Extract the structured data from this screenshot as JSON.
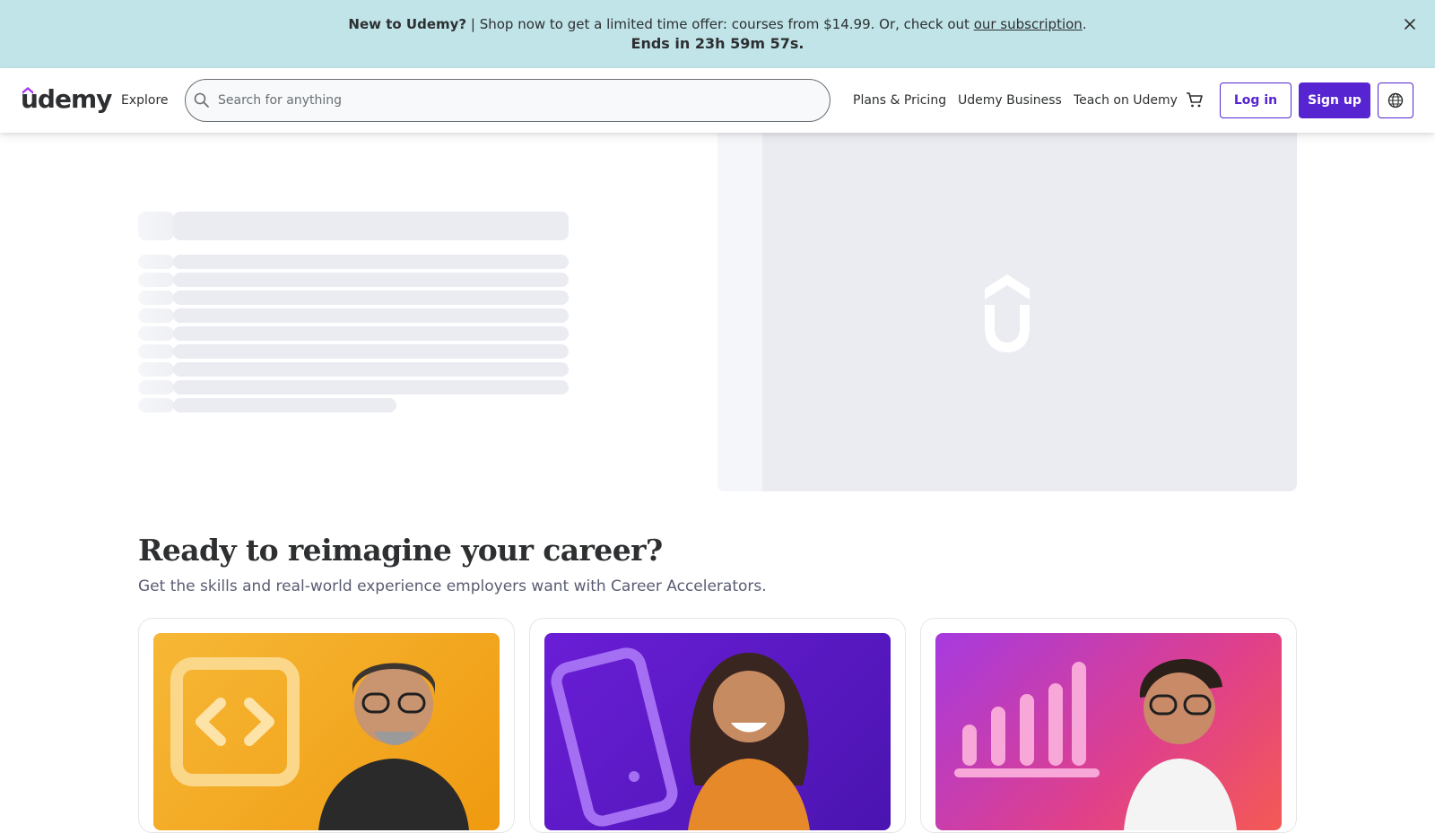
{
  "promo": {
    "bold": "New to Udemy?",
    "text": " | Shop now to get a limited time offer: courses from $14.99. Or, check out ",
    "link": "our subscription",
    "suffix": ".",
    "countdown": "Ends in 23h 59m 57s."
  },
  "header": {
    "logo": "udemy",
    "explore": "Explore",
    "search_placeholder": "Search for anything",
    "plans": "Plans & Pricing",
    "business": "Udemy Business",
    "teach": "Teach on Udemy",
    "login": "Log in",
    "signup": "Sign up"
  },
  "career": {
    "title": "Ready to reimagine your career?",
    "subtitle": "Get the skills and real-world experience employers want with Career Accelerators."
  },
  "colors": {
    "brand": "#5624d0",
    "banner": "#c0e4e8",
    "skeleton": "#ebecf2"
  },
  "icons": [
    "close-icon",
    "search-icon",
    "cart-icon",
    "globe-icon",
    "code-icon",
    "phone-icon",
    "bar-chart-icon"
  ]
}
